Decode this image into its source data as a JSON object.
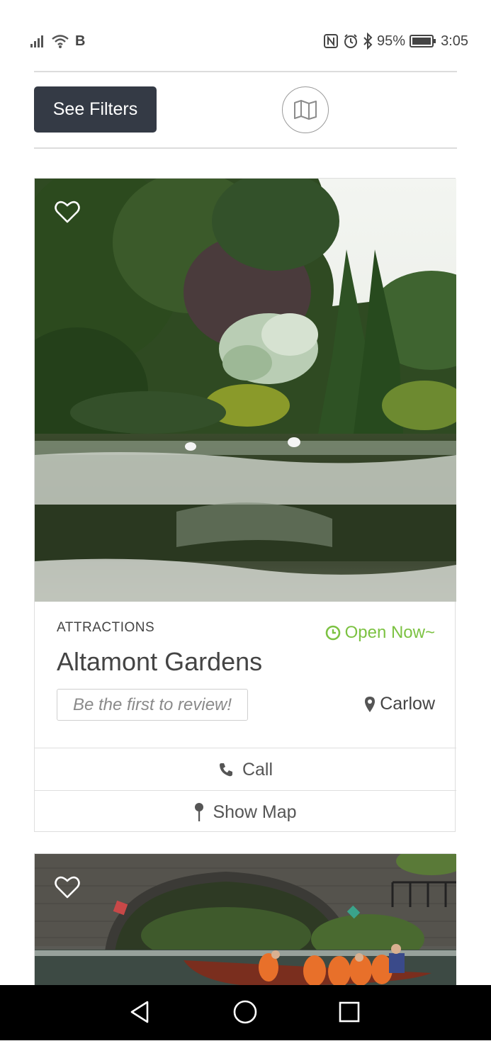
{
  "status_bar": {
    "carrier": "B",
    "battery_percent": "95%",
    "time": "3:05",
    "icons": [
      "signal-icon",
      "wifi-icon",
      "nfc-icon",
      "alarm-icon",
      "bluetooth-icon",
      "battery-icon"
    ]
  },
  "toolbar": {
    "filters_label": "See Filters",
    "map_icon": "map-icon"
  },
  "listings": [
    {
      "category": "ATTRACTIONS",
      "status": "Open Now~",
      "title": "Altamont Gardens",
      "review_prompt": "Be the first to review!",
      "location": "Carlow",
      "actions": {
        "call": "Call",
        "map": "Show Map"
      }
    },
    {
      "category": "",
      "title": ""
    }
  ],
  "colors": {
    "button_dark": "#343a45",
    "open_green": "#7cc242",
    "text": "#444444",
    "border": "#dedede"
  },
  "nav": {
    "icons": [
      "back-icon",
      "home-icon",
      "recents-icon"
    ]
  }
}
